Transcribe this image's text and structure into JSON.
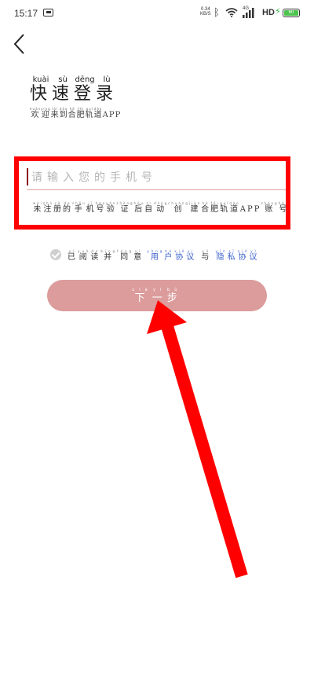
{
  "status_bar": {
    "time": "15:17",
    "net_speed": "0.34",
    "net_unit": "KB/S",
    "network": "4G",
    "hd": "HD",
    "battery": "60"
  },
  "header": {
    "title": [
      {
        "char": "快",
        "pinyin": "kuài"
      },
      {
        "char": "速",
        "pinyin": "sù"
      },
      {
        "char": "登",
        "pinyin": "dēng"
      },
      {
        "char": "录",
        "pinyin": "lù"
      }
    ],
    "subtitle": [
      {
        "char": "欢",
        "pinyin": "huān"
      },
      {
        "char": "迎",
        "pinyin": "yíng"
      },
      {
        "char": "来",
        "pinyin": "lái"
      },
      {
        "char": "到",
        "pinyin": "dào"
      },
      {
        "char": "合",
        "pinyin": "hé"
      },
      {
        "char": "肥",
        "pinyin": "féi"
      },
      {
        "char": "轨",
        "pinyin": "guǐ"
      },
      {
        "char": "道",
        "pinyin": "dào"
      },
      {
        "char": "APP",
        "pinyin": ""
      }
    ]
  },
  "form": {
    "phone_placeholder": "请输入您的手机号",
    "phone_value": "",
    "hint": [
      {
        "char": "未",
        "pinyin": "wèi"
      },
      {
        "char": "注",
        "pinyin": "zhù"
      },
      {
        "char": "册",
        "pinyin": "cè"
      },
      {
        "char": "的",
        "pinyin": "de"
      },
      {
        "char": "手",
        "pinyin": "shǒu"
      },
      {
        "char": "机",
        "pinyin": "jī"
      },
      {
        "char": "号",
        "pinyin": "hào"
      },
      {
        "char": "验",
        "pinyin": "yàn"
      },
      {
        "char": "证",
        "pinyin": "zhèng"
      },
      {
        "char": "后",
        "pinyin": "hòu"
      },
      {
        "char": "自",
        "pinyin": "zì"
      },
      {
        "char": "动",
        "pinyin": "dòng"
      },
      {
        "char": "创",
        "pinyin": "chuàng"
      },
      {
        "char": "建",
        "pinyin": "jiàn"
      },
      {
        "char": "合",
        "pinyin": "hé"
      },
      {
        "char": "肥",
        "pinyin": "féi"
      },
      {
        "char": "轨",
        "pinyin": "guǐ"
      },
      {
        "char": "道",
        "pinyin": "dào"
      },
      {
        "char": "APP",
        "pinyin": ""
      },
      {
        "char": "账",
        "pinyin": "zhàng"
      },
      {
        "char": "号",
        "pinyin": "hào"
      }
    ]
  },
  "agreement": {
    "checked": false,
    "prefix": [
      {
        "char": "已",
        "pinyin": "yǐ"
      },
      {
        "char": "阅",
        "pinyin": "yuè"
      },
      {
        "char": "读",
        "pinyin": "dú"
      },
      {
        "char": "并",
        "pinyin": "bìng"
      },
      {
        "char": "同",
        "pinyin": "tóng"
      },
      {
        "char": "意",
        "pinyin": "yì"
      }
    ],
    "user_link": [
      {
        "char": "用",
        "pinyin": "yòng"
      },
      {
        "char": "户",
        "pinyin": "hù"
      },
      {
        "char": "协",
        "pinyin": "xié"
      },
      {
        "char": "议",
        "pinyin": "yì"
      }
    ],
    "conj": [
      {
        "char": "与",
        "pinyin": "yǔ"
      }
    ],
    "privacy_link": [
      {
        "char": "隐",
        "pinyin": "yǐn"
      },
      {
        "char": "私",
        "pinyin": "sī"
      },
      {
        "char": "协",
        "pinyin": "xié"
      },
      {
        "char": "议",
        "pinyin": "yì"
      }
    ]
  },
  "next_button": [
    {
      "char": "下",
      "pinyin": "xià"
    },
    {
      "char": "一",
      "pinyin": "yī"
    },
    {
      "char": "步",
      "pinyin": "bù"
    }
  ],
  "colors": {
    "highlight": "#ff0000",
    "button": "#dc9c9c",
    "link": "#3a5fcd",
    "caret": "#8b1a1a"
  }
}
